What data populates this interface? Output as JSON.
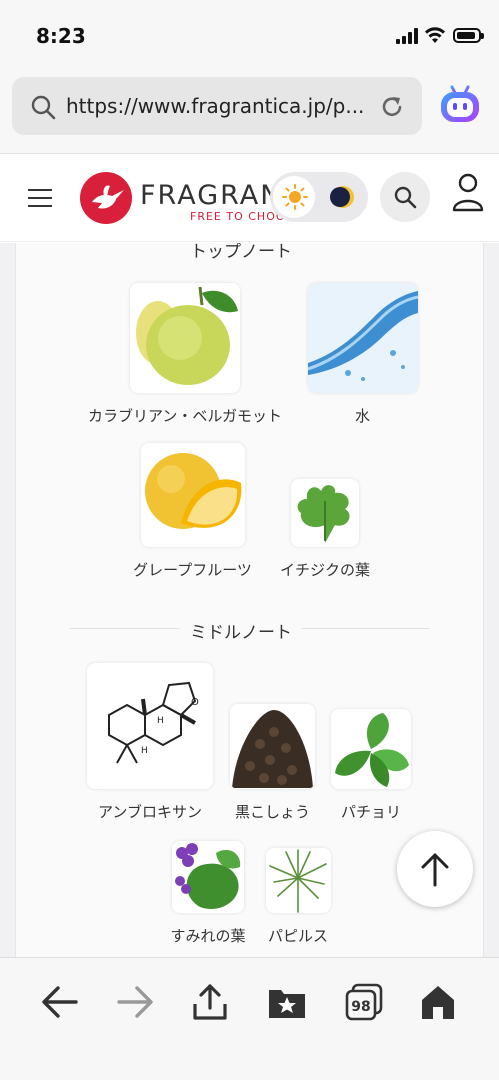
{
  "status_bar": {
    "time": "8:23"
  },
  "browser": {
    "url": "https://www.fragrantica.jp/p...",
    "tabs_count": "98"
  },
  "site": {
    "logo_text": "FRAGRANTICA",
    "logo_tagline": "FREE TO CHOOSE"
  },
  "sections": {
    "top": {
      "title": "トップノート",
      "notes": [
        {
          "name": "カラブリアン・ベルガモット",
          "icon": "bergamot"
        },
        {
          "name": "水",
          "icon": "water"
        },
        {
          "name": "グレープフルーツ",
          "icon": "grapefruit"
        },
        {
          "name": "イチジクの葉",
          "icon": "fig-leaf"
        }
      ]
    },
    "middle": {
      "title": "ミドルノート",
      "notes": [
        {
          "name": "アンブロキサン",
          "icon": "molecule"
        },
        {
          "name": "黒こしょう",
          "icon": "black-pepper"
        },
        {
          "name": "パチョリ",
          "icon": "patchouli"
        },
        {
          "name": "すみれの葉",
          "icon": "violet-leaf"
        },
        {
          "name": "パピルス",
          "icon": "papyrus"
        }
      ]
    }
  },
  "toolbar": {
    "items": [
      "back-icon",
      "forward-icon",
      "share-icon",
      "bookmarks-icon",
      "tabs-icon",
      "home-icon"
    ]
  },
  "colors": {
    "brand": "#d8203a",
    "background": "#f1f1f3"
  }
}
